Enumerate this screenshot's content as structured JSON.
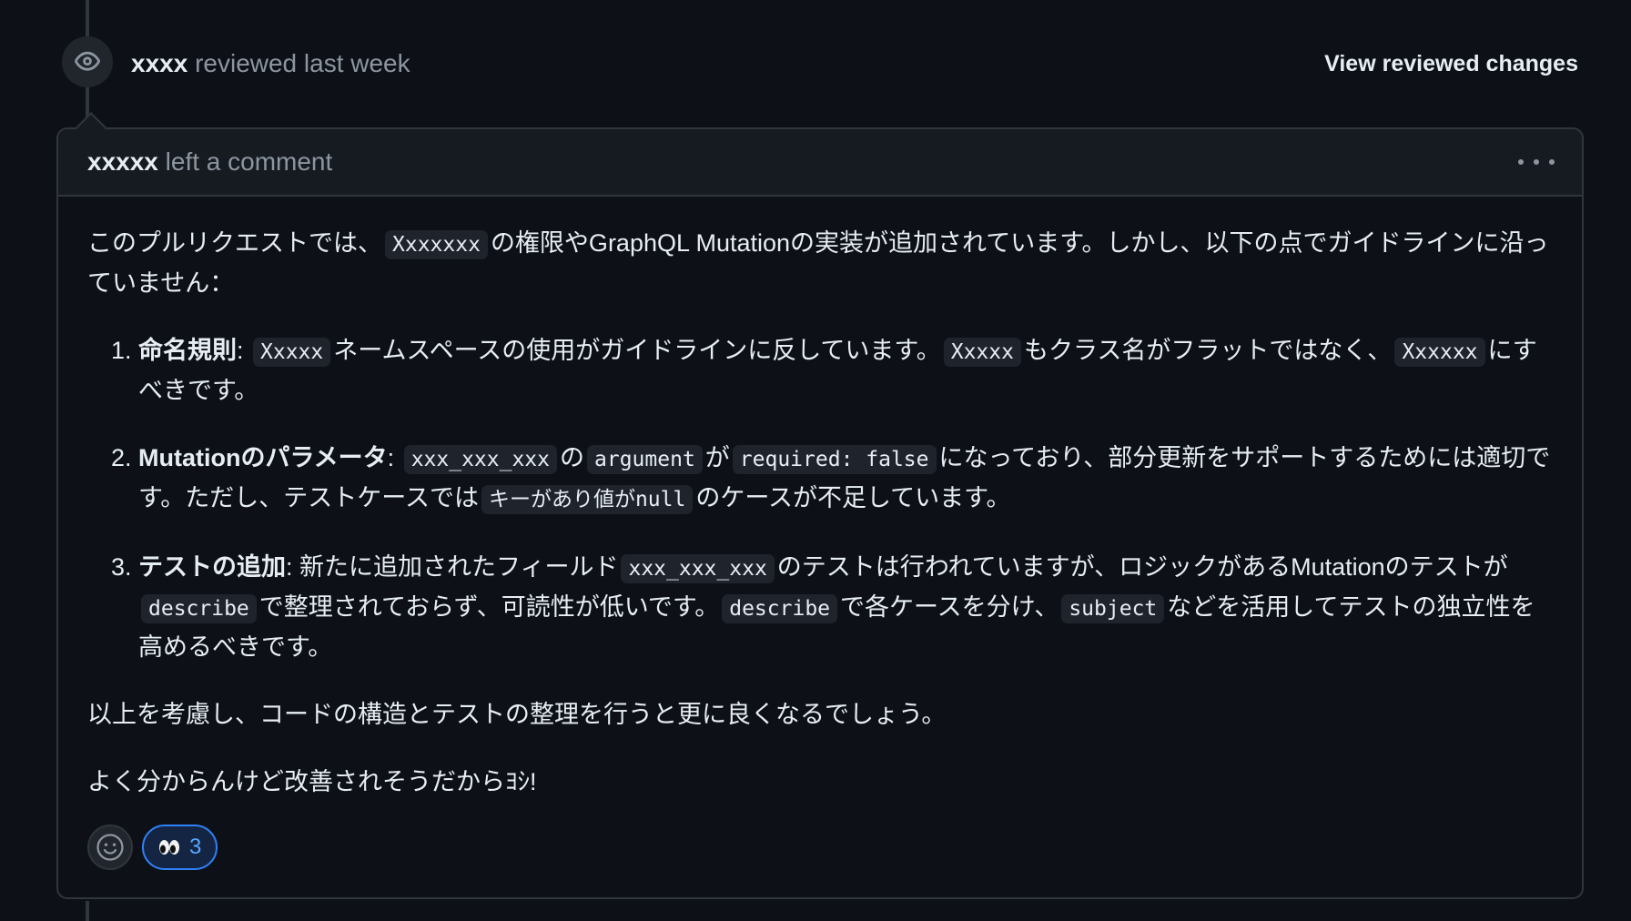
{
  "review": {
    "reviewer": "xxxx",
    "action": "reviewed last week",
    "view_changes_label": "View reviewed changes"
  },
  "comment": {
    "author": "xxxxx",
    "action": "left a comment",
    "intro_before": "このプルリクエストでは、",
    "intro_code": "Xxxxxxx",
    "intro_after": "の権限やGraphQL Mutationの実装が追加されています。しかし、以下の点でガイドラインに沿っていません：",
    "items": [
      {
        "title": "命名規則",
        "parts": [
          {
            "text": ": "
          },
          {
            "code": "Xxxxx"
          },
          {
            "text": "ネームスペースの使用がガイドラインに反しています。"
          },
          {
            "code": "Xxxxx"
          },
          {
            "text": "もクラス名がフラットではなく、"
          },
          {
            "code": "Xxxxxx"
          },
          {
            "text": "にすべきです。"
          }
        ]
      },
      {
        "title": "Mutationのパラメータ",
        "parts": [
          {
            "text": ": "
          },
          {
            "code": "xxx_xxx_xxx"
          },
          {
            "text": "の"
          },
          {
            "code": "argument"
          },
          {
            "text": "が"
          },
          {
            "code": "required: false"
          },
          {
            "text": "になっており、部分更新をサポートするためには適切です。ただし、テストケースでは"
          },
          {
            "code": "キーがあり値がnull"
          },
          {
            "text": "のケースが不足しています。"
          }
        ]
      },
      {
        "title": "テストの追加",
        "parts": [
          {
            "text": ": 新たに追加されたフィールド"
          },
          {
            "code": "xxx_xxx_xxx"
          },
          {
            "text": "のテストは行われていますが、ロジックがあるMutationのテストが"
          },
          {
            "code": "describe"
          },
          {
            "text": "で整理されておらず、可読性が低いです。"
          },
          {
            "code": "describe"
          },
          {
            "text": "で各ケースを分け、"
          },
          {
            "code": "subject"
          },
          {
            "text": "などを活用してテストの独立性を高めるべきです。"
          }
        ]
      }
    ],
    "conclusion": "以上を考慮し、コードの構造とテストの整理を行うと更に良くなるでしょう。",
    "closing": "よく分からんけど改善されそうだからﾖｼ!"
  },
  "reactions": {
    "add_reaction_icon": "smiley-icon",
    "items": [
      {
        "emoji_name": "eyes-emoji",
        "count": "3"
      }
    ]
  },
  "icons": {
    "review_icon": "eye-icon",
    "more_icon": "kebab-horizontal-icon"
  },
  "colors": {
    "background": "#0d1117",
    "border": "#30363d",
    "header_bg": "#161b22",
    "muted_text": "#8d96a0",
    "accent": "#2f81f7",
    "reaction_count": "#58a6ff"
  }
}
